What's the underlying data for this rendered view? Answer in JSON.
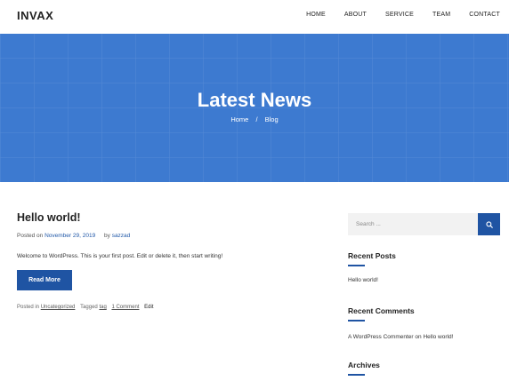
{
  "header": {
    "logo": "INVAX",
    "nav": [
      "HOME",
      "ABOUT",
      "SERVICE",
      "TEAM",
      "CONTACT"
    ]
  },
  "hero": {
    "title": "Latest News",
    "breadcrumb_home": "Home",
    "breadcrumb_sep": "/",
    "breadcrumb_current": "Blog"
  },
  "post": {
    "title": "Hello world!",
    "posted_on_label": "Posted on",
    "date": "November 29, 2019",
    "by_label": "by",
    "author": "sazzad",
    "excerpt": "Welcome to WordPress. This is your first post. Edit or delete it, then start writing!",
    "read_more": "Read More",
    "posted_in_label": "Posted in",
    "category": "Uncategorized",
    "tagged_label": "Tagged",
    "tag": "tag",
    "comments": "1 Comment",
    "edit": "Edit"
  },
  "sidebar": {
    "search_placeholder": "Search ...",
    "recent_posts_title": "Recent Posts",
    "recent_post_1": "Hello world!",
    "recent_comments_title": "Recent Comments",
    "comment_author": "A WordPress Commenter",
    "comment_on": "on",
    "comment_post": "Hello world!",
    "archives_title": "Archives"
  },
  "colors": {
    "accent": "#1f54a3",
    "hero_bg": "#3d7ad0"
  }
}
